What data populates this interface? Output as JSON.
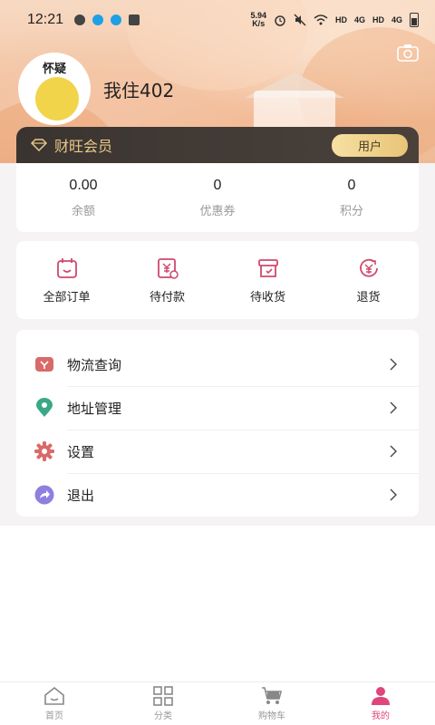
{
  "status_bar": {
    "time": "12:21",
    "net_speed_value": "5.94",
    "net_speed_unit": "K/s",
    "hd1": "HD",
    "sig1": "4G",
    "hd2": "HD",
    "sig2": "4G"
  },
  "profile": {
    "avatar_text": "怀疑",
    "username": "我住402"
  },
  "member": {
    "label": "财旺会员",
    "badge": "用户"
  },
  "stats": [
    {
      "value": "0.00",
      "label": "余额"
    },
    {
      "value": "0",
      "label": "优惠券"
    },
    {
      "value": "0",
      "label": "积分"
    }
  ],
  "orders": [
    {
      "label": "全部订单",
      "icon": "calendar-order-icon"
    },
    {
      "label": "待付款",
      "icon": "yen-bill-icon"
    },
    {
      "label": "待收货",
      "icon": "box-check-icon"
    },
    {
      "label": "退货",
      "icon": "yen-return-icon"
    }
  ],
  "menu": [
    {
      "label": "物流查询",
      "icon": "logistics-icon",
      "color": "#d96a6a"
    },
    {
      "label": "地址管理",
      "icon": "location-icon",
      "color": "#3aa887"
    },
    {
      "label": "设置",
      "icon": "gear-icon",
      "color": "#d96a6a"
    },
    {
      "label": "退出",
      "icon": "logout-icon",
      "color": "#8e7fe0"
    }
  ],
  "tabbar": [
    {
      "label": "首页",
      "icon": "home-icon"
    },
    {
      "label": "分类",
      "icon": "grid-icon"
    },
    {
      "label": "购物车",
      "icon": "cart-icon"
    },
    {
      "label": "我的",
      "icon": "user-icon",
      "active": true
    }
  ],
  "colors": {
    "accent": "#e0457b",
    "member_gold": "#e8c98a",
    "order_icon": "#d0486e"
  }
}
